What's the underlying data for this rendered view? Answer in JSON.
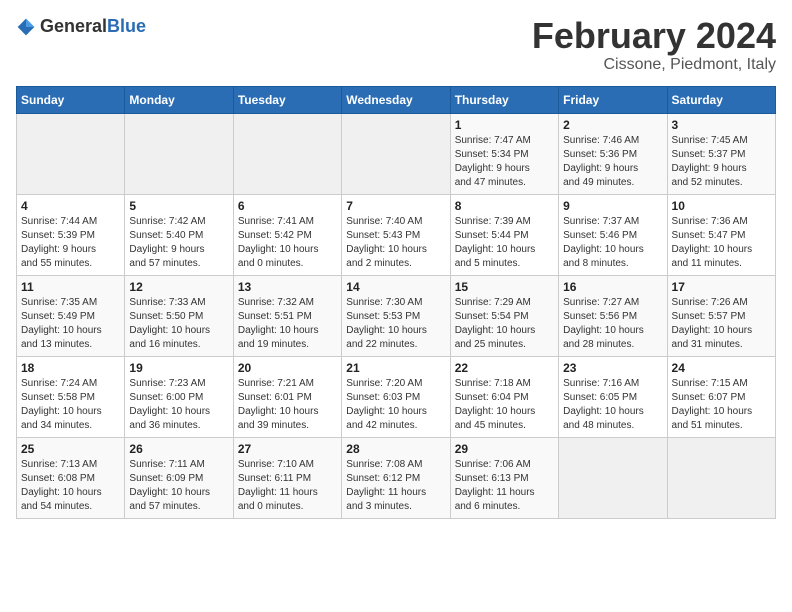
{
  "header": {
    "logo_general": "General",
    "logo_blue": "Blue",
    "title": "February 2024",
    "subtitle": "Cissone, Piedmont, Italy"
  },
  "days_of_week": [
    "Sunday",
    "Monday",
    "Tuesday",
    "Wednesday",
    "Thursday",
    "Friday",
    "Saturday"
  ],
  "weeks": [
    [
      {
        "day": "",
        "info": ""
      },
      {
        "day": "",
        "info": ""
      },
      {
        "day": "",
        "info": ""
      },
      {
        "day": "",
        "info": ""
      },
      {
        "day": "1",
        "info": "Sunrise: 7:47 AM\nSunset: 5:34 PM\nDaylight: 9 hours\nand 47 minutes."
      },
      {
        "day": "2",
        "info": "Sunrise: 7:46 AM\nSunset: 5:36 PM\nDaylight: 9 hours\nand 49 minutes."
      },
      {
        "day": "3",
        "info": "Sunrise: 7:45 AM\nSunset: 5:37 PM\nDaylight: 9 hours\nand 52 minutes."
      }
    ],
    [
      {
        "day": "4",
        "info": "Sunrise: 7:44 AM\nSunset: 5:39 PM\nDaylight: 9 hours\nand 55 minutes."
      },
      {
        "day": "5",
        "info": "Sunrise: 7:42 AM\nSunset: 5:40 PM\nDaylight: 9 hours\nand 57 minutes."
      },
      {
        "day": "6",
        "info": "Sunrise: 7:41 AM\nSunset: 5:42 PM\nDaylight: 10 hours\nand 0 minutes."
      },
      {
        "day": "7",
        "info": "Sunrise: 7:40 AM\nSunset: 5:43 PM\nDaylight: 10 hours\nand 2 minutes."
      },
      {
        "day": "8",
        "info": "Sunrise: 7:39 AM\nSunset: 5:44 PM\nDaylight: 10 hours\nand 5 minutes."
      },
      {
        "day": "9",
        "info": "Sunrise: 7:37 AM\nSunset: 5:46 PM\nDaylight: 10 hours\nand 8 minutes."
      },
      {
        "day": "10",
        "info": "Sunrise: 7:36 AM\nSunset: 5:47 PM\nDaylight: 10 hours\nand 11 minutes."
      }
    ],
    [
      {
        "day": "11",
        "info": "Sunrise: 7:35 AM\nSunset: 5:49 PM\nDaylight: 10 hours\nand 13 minutes."
      },
      {
        "day": "12",
        "info": "Sunrise: 7:33 AM\nSunset: 5:50 PM\nDaylight: 10 hours\nand 16 minutes."
      },
      {
        "day": "13",
        "info": "Sunrise: 7:32 AM\nSunset: 5:51 PM\nDaylight: 10 hours\nand 19 minutes."
      },
      {
        "day": "14",
        "info": "Sunrise: 7:30 AM\nSunset: 5:53 PM\nDaylight: 10 hours\nand 22 minutes."
      },
      {
        "day": "15",
        "info": "Sunrise: 7:29 AM\nSunset: 5:54 PM\nDaylight: 10 hours\nand 25 minutes."
      },
      {
        "day": "16",
        "info": "Sunrise: 7:27 AM\nSunset: 5:56 PM\nDaylight: 10 hours\nand 28 minutes."
      },
      {
        "day": "17",
        "info": "Sunrise: 7:26 AM\nSunset: 5:57 PM\nDaylight: 10 hours\nand 31 minutes."
      }
    ],
    [
      {
        "day": "18",
        "info": "Sunrise: 7:24 AM\nSunset: 5:58 PM\nDaylight: 10 hours\nand 34 minutes."
      },
      {
        "day": "19",
        "info": "Sunrise: 7:23 AM\nSunset: 6:00 PM\nDaylight: 10 hours\nand 36 minutes."
      },
      {
        "day": "20",
        "info": "Sunrise: 7:21 AM\nSunset: 6:01 PM\nDaylight: 10 hours\nand 39 minutes."
      },
      {
        "day": "21",
        "info": "Sunrise: 7:20 AM\nSunset: 6:03 PM\nDaylight: 10 hours\nand 42 minutes."
      },
      {
        "day": "22",
        "info": "Sunrise: 7:18 AM\nSunset: 6:04 PM\nDaylight: 10 hours\nand 45 minutes."
      },
      {
        "day": "23",
        "info": "Sunrise: 7:16 AM\nSunset: 6:05 PM\nDaylight: 10 hours\nand 48 minutes."
      },
      {
        "day": "24",
        "info": "Sunrise: 7:15 AM\nSunset: 6:07 PM\nDaylight: 10 hours\nand 51 minutes."
      }
    ],
    [
      {
        "day": "25",
        "info": "Sunrise: 7:13 AM\nSunset: 6:08 PM\nDaylight: 10 hours\nand 54 minutes."
      },
      {
        "day": "26",
        "info": "Sunrise: 7:11 AM\nSunset: 6:09 PM\nDaylight: 10 hours\nand 57 minutes."
      },
      {
        "day": "27",
        "info": "Sunrise: 7:10 AM\nSunset: 6:11 PM\nDaylight: 11 hours\nand 0 minutes."
      },
      {
        "day": "28",
        "info": "Sunrise: 7:08 AM\nSunset: 6:12 PM\nDaylight: 11 hours\nand 3 minutes."
      },
      {
        "day": "29",
        "info": "Sunrise: 7:06 AM\nSunset: 6:13 PM\nDaylight: 11 hours\nand 6 minutes."
      },
      {
        "day": "",
        "info": ""
      },
      {
        "day": "",
        "info": ""
      }
    ]
  ]
}
